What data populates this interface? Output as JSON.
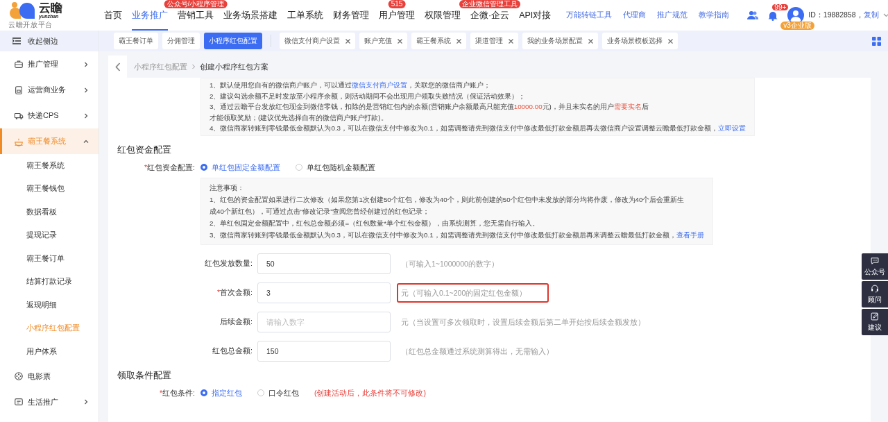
{
  "header": {
    "logo": {
      "name": "云瞻",
      "sub": "yunzhan",
      "tagline": "云 瞻 开 放 平 台"
    },
    "nav": [
      {
        "label": "首页",
        "selected": false
      },
      {
        "label": "业务推广",
        "selected": true
      },
      {
        "label": "营销工具",
        "selected": false,
        "badge": "公众号/小程序管理"
      },
      {
        "label": "业务场景搭建",
        "selected": false
      },
      {
        "label": "工单系统",
        "selected": false
      },
      {
        "label": "财务管理",
        "selected": false
      },
      {
        "label": "用户管理",
        "selected": false,
        "badge": "515"
      },
      {
        "label": "权限管理",
        "selected": false
      },
      {
        "label": "企微·企云",
        "selected": false,
        "badge": "企业微信管理工具"
      },
      {
        "label": "API对接",
        "selected": false
      }
    ],
    "links": [
      "万能转链工具",
      "代理商",
      "推广规范",
      "教学指南"
    ],
    "notification_badge": "99+",
    "user": {
      "plan": "v3企业版",
      "id": "ID：19882858，",
      "copy": "复制"
    }
  },
  "sidebar": {
    "collapse": "收起侧边",
    "items": [
      {
        "label": "推广管理",
        "kind": "group",
        "expanded": false,
        "selected": false
      },
      {
        "label": "运营商业务",
        "kind": "group",
        "expanded": false,
        "selected": false
      },
      {
        "label": "快递CPS",
        "kind": "group",
        "expanded": false,
        "selected": false
      },
      {
        "label": "霸王餐系统",
        "kind": "group",
        "expanded": true,
        "selected": true,
        "children": [
          {
            "label": "霸王餐系统",
            "selected": false
          },
          {
            "label": "霸王餐钱包",
            "selected": false
          },
          {
            "label": "数据看板",
            "selected": false
          },
          {
            "label": "提现记录",
            "selected": false
          },
          {
            "label": "霸王餐订单",
            "selected": false
          },
          {
            "label": "结算打款记录",
            "selected": false
          },
          {
            "label": "返现明细",
            "selected": false
          },
          {
            "label": "小程序红包配置",
            "selected": true
          },
          {
            "label": "用户体系",
            "selected": false
          }
        ]
      },
      {
        "label": "电影票",
        "kind": "link",
        "selected": false
      },
      {
        "label": "生活推广",
        "kind": "group",
        "expanded": false,
        "selected": false
      }
    ]
  },
  "tabs": [
    {
      "label": "霸王餐订单",
      "selected": false,
      "closable": false
    },
    {
      "label": "分佣管理",
      "selected": false,
      "closable": false
    },
    {
      "label": "小程序红包配置",
      "selected": true,
      "closable": false
    },
    {
      "label": "微信支付商户设置",
      "selected": false,
      "closable": true
    },
    {
      "label": "账户充值",
      "selected": false,
      "closable": true
    },
    {
      "label": "霸王餐系统",
      "selected": false,
      "closable": true
    },
    {
      "label": "渠道管理",
      "selected": false,
      "closable": true
    },
    {
      "label": "我的业务场景配置",
      "selected": false,
      "closable": true
    },
    {
      "label": "业务场景模板选择",
      "selected": false,
      "closable": true
    }
  ],
  "breadcrumb": [
    "小程序红包配置",
    "创建小程序红包方案"
  ],
  "top_notice": [
    [
      {
        "kind": "text",
        "text": "1、默认使用您自有的微信商户账户，可以通过"
      },
      {
        "kind": "link",
        "text": "微信支付商户设置"
      },
      {
        "kind": "text",
        "text": "，关联您的微信商户账户；"
      }
    ],
    [
      {
        "kind": "text",
        "text": "2、建议勾选余额不足时发放至小程序余额，则活动期间不会出现用户领取失败情况（保证活动效果）；"
      }
    ],
    [
      {
        "kind": "text",
        "text": "3、通过云瞻平台发放红包现金到微信零钱，扣除的是营销红包内的余额(营销账户余额最高只能充值"
      },
      {
        "kind": "warn",
        "text": "10000.00"
      },
      {
        "kind": "text",
        "text": "元)，并且未实名的用户"
      },
      {
        "kind": "warn",
        "text": "需要实名"
      },
      {
        "kind": "text",
        "text": "后"
      }
    ],
    [
      {
        "kind": "text",
        "text": "才能领取奖励；(建议优先选择自有的微信商户账户打款)。"
      }
    ],
    [
      {
        "kind": "text",
        "text": "4、微信商家转账到零钱最低金额默认为0.3，可以在微信支付中修改为0.1，如需调整请先到微信支付中修改最低打款金额后再去微信商户设置调整云瞻最低打款金额，"
      },
      {
        "kind": "link",
        "text": "立即设置"
      }
    ]
  ],
  "fund_section": {
    "title": "红包资金配置",
    "label": "红包资金配置:",
    "mark": "*",
    "options": [
      {
        "label": "单红包固定金额配置",
        "selected": true
      },
      {
        "label": "单红包随机金额配置",
        "selected": false
      }
    ],
    "notice": [
      [
        {
          "kind": "text",
          "text": "注意事项："
        }
      ],
      [
        {
          "kind": "text",
          "text": "1、红包的资金配置如果进行二次修改（如果您第1次创建50个红包，修改为40个，则此前创建的50个红包中未发放的部分均将作废，修改为40个后会重新生"
        }
      ],
      [
        {
          "kind": "text",
          "text": "成40个新红包），可通过点击“修改记录”查阅您曾经创建过的红包记录；"
        }
      ],
      [
        {
          "kind": "text",
          "text": "2、单红包固定金额配置中，红包总金额必须=（红包数量*单个红包金额），由系统测算，您无需自行输入。"
        }
      ],
      [
        {
          "kind": "text",
          "text": "3、微信商家转账到零钱最低金额默认为0.3，可以在微信支付中修改为0.1，如需调整请先到微信支付中修改最低打款金额后再来调整云瞻最低打款金额，"
        },
        {
          "kind": "link",
          "text": "查看手册"
        }
      ]
    ],
    "fields": [
      {
        "label": "红包发放数量:",
        "value": "50",
        "hint": "（可输入1~1000000的数字）",
        "highlighted": false
      },
      {
        "label": "首次金额:",
        "mark": "*",
        "value": "3",
        "hint": "元（可输入0.1~200的固定红包金额）",
        "highlighted": true
      },
      {
        "label": "后续金额:",
        "placeholder": "请输入数字",
        "hint": "元（当设置可多次领取时，设置后续金额后第二单开始按后续金额发放）",
        "highlighted": false
      },
      {
        "label": "红包总金额:",
        "value": "150",
        "hint": "（红包总金额通过系统测算得出，无需输入）",
        "highlighted": false
      }
    ]
  },
  "condition_section": {
    "title": "领取条件配置",
    "label": "红包条件:",
    "mark": "*",
    "options": [
      {
        "label": "指定红包",
        "selected": true
      },
      {
        "label": "口令红包",
        "selected": false
      }
    ],
    "warning": "(创建活动后，此条件将不可修改)"
  },
  "float_buttons": [
    "公众号",
    "顾问",
    "建议"
  ]
}
